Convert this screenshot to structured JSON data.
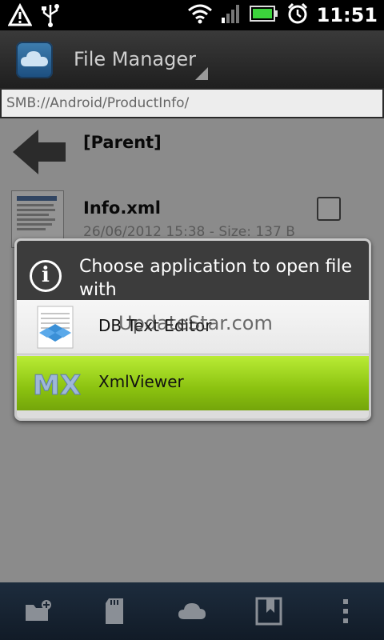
{
  "status_bar": {
    "time": "11:51",
    "icons": [
      "warning-icon",
      "usb-icon",
      "wifi-icon",
      "signal-icon",
      "battery-icon",
      "alarm-icon"
    ]
  },
  "action_bar": {
    "title": "File Manager",
    "icon": "cloud-app-icon"
  },
  "path_bar": {
    "path": "SMB://Android/ProductInfo/"
  },
  "file_list": {
    "items": [
      {
        "label": "[Parent]",
        "icon": "back-arrow-icon"
      },
      {
        "label": "Info.xml",
        "meta": "26/06/2012 15:38 - Size: 137 B",
        "icon": "document-icon",
        "checked": false
      }
    ]
  },
  "dialog": {
    "title": "Choose application to open file with",
    "icon": "info-icon",
    "options": [
      {
        "label": "DB Text Editor",
        "icon": "db-text-editor-icon"
      },
      {
        "label": "XmlViewer",
        "icon": "xml-viewer-icon"
      }
    ]
  },
  "watermark": "UpdateStar.com",
  "bottom_bar": {
    "buttons": [
      "new-folder-icon",
      "sd-card-icon",
      "cloud-icon",
      "bookmark-icon",
      "overflow-menu-icon"
    ]
  },
  "colors": {
    "selection_green": "#8bc210",
    "dialog_header": "#3c3c3c",
    "toolbar_blue": "#1d2c3d"
  }
}
